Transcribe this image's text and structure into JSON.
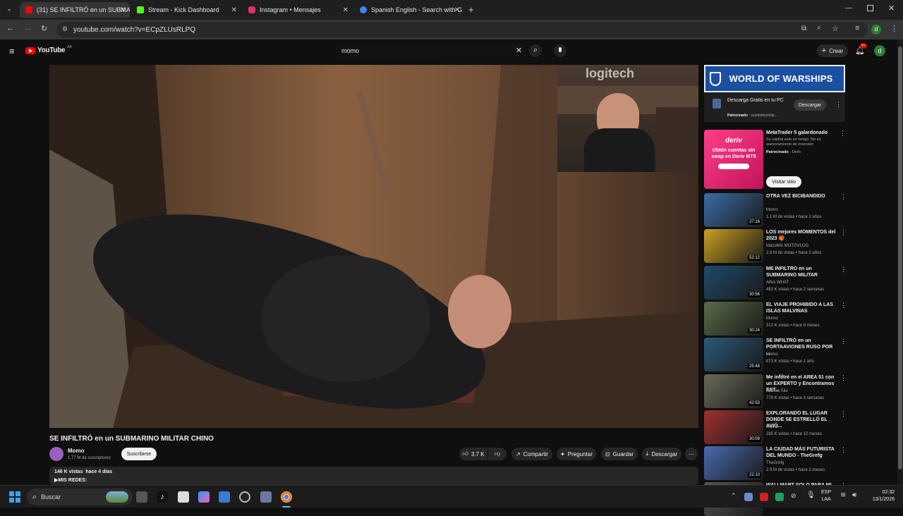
{
  "browser": {
    "tabs": [
      {
        "title": "(31) SE INFILTRÓ en un SUBMA",
        "color": "#ff0000"
      },
      {
        "title": "Stream - Kick Dashboard",
        "color": "#53fc18"
      },
      {
        "title": "Instagram • Mensajes",
        "color": "#e1306c"
      },
      {
        "title": "Spanish English - Search with G",
        "color": "#4285f4"
      }
    ],
    "url": "youtube.com/watch?v=ECpZLUsRLPQ",
    "profile_letter": "d"
  },
  "youtube": {
    "logo": "YouTube",
    "region": "AR",
    "search_value": "momo",
    "create_label": "Crear",
    "notif_badge": "9+",
    "avatar_letter": "d"
  },
  "video": {
    "title": "SE INFILTRÓ en un SUBMARINO MILITAR CHINO",
    "channel": "Momo",
    "subscribers": "1.77 M de suscriptores",
    "subscribe_label": "Suscribirse",
    "likes": "3.7 K",
    "share_label": "Compartir",
    "ask_label": "Preguntar",
    "save_label": "Guardar",
    "download_label": "Descargar",
    "views_meta": "146 K vistas  hace 4 días",
    "description_line": "▶MIS REDES:",
    "cam_brand": "logitech"
  },
  "ad": {
    "banner": "WORLD OF WARSHIPS",
    "title": "Descarga Gratis en tu PC",
    "sponsored": "Patrocinado",
    "domain": "· worldofwarship...",
    "cta": "Descargar"
  },
  "ad2": {
    "thumb_brand": "deriv",
    "thumb_text": "Obtén cuentas sin swap en Deriv MT5",
    "title": "MetaTrader 5 galardonado",
    "desc": "Su capital está en riesgo. No es asesoramiento de inversión",
    "sponsored": "Patrocinado",
    "domain": "· Deriv",
    "cta": "Visitar sitio"
  },
  "recommendations": [
    {
      "title": "OTRA VEZ BICIBANDIDO",
      "channel": "Momo",
      "meta": "1.1 M de vistas • hace 2 años",
      "duration": "27:16"
    },
    {
      "title": "LOS mejores MOMENTOS del 2023 🎁",
      "channel": "MacoMix MOTOVLOG",
      "meta": "2.8 M de vistas • hace 2 años",
      "duration": "52:12"
    },
    {
      "title": "ME INFILTRO en un SUBMARINO MILITAR",
      "channel": "Alfos WHAT",
      "meta": "452 K vistas • hace 2 semanas",
      "duration": "30:56"
    },
    {
      "title": "EL VIAJE PROHIBIDO A LAS ISLAS MALVINAS",
      "channel": "Momo",
      "meta": "312 K vistas • hace 9 meses",
      "duration": "30:24"
    },
    {
      "title": "SE INFILTRÓ en un PORTAAVIONES RUSO POR ...",
      "channel": "Momo",
      "meta": "873 K vistas • hace 1 año",
      "duration": "25:48"
    },
    {
      "title": "Me infiltré en el AREA 51 con un EXPERTO y Encontramos EST...",
      "channel": "Andres Sile",
      "meta": "776 K vistas • hace 3 semanas",
      "duration": "42:53"
    },
    {
      "title": "EXPLORANDO EL LUGAR DONDE SE ESTRELLÓ EL AVIÓ...",
      "channel": "Momo",
      "meta": "285 K vistas • hace 10 meses",
      "duration": "30:09"
    },
    {
      "title": "LA CIUDAD MÁS FUTURISTA DEL MUNDO - TheGrefg",
      "channel": "TheGrefg",
      "meta": "2.9 M de vistas • hace 2 meses",
      "duration": "22:10"
    },
    {
      "title": "WALLMART SOLO PARA MI",
      "channel": "",
      "meta": "",
      "duration": ""
    }
  ],
  "taskbar": {
    "search_label": "Buscar",
    "lang": "ESP",
    "lang2": "LAA",
    "time": "02:32",
    "date": "13/1/2026"
  }
}
